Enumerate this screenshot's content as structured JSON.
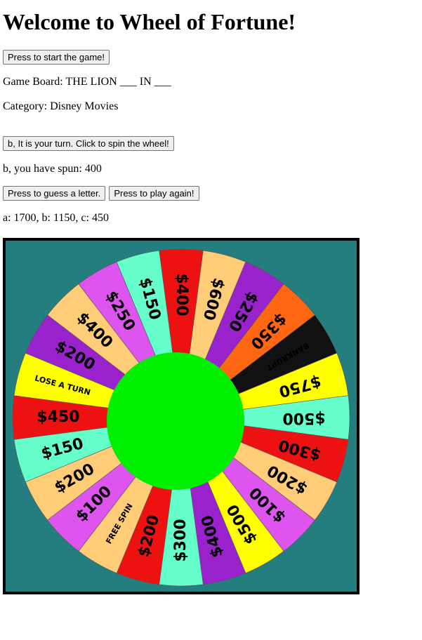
{
  "page": {
    "title": "Welcome to Wheel of Fortune!",
    "start_button": "Press to start the game!",
    "game_board": "Game Board: THE LION ___ IN ___",
    "category": "Category: Disney Movies",
    "spin_button": "b, It is your turn. Click to spin the wheel!",
    "spun_text": "b, you have spun: 400",
    "guess_button": "Press to guess a letter.",
    "play_again_button": "Press to play again!",
    "scores": "a: 1700, b: 1150, c: 450"
  },
  "wheel": {
    "background_color": "#247e80",
    "hub_color": "#00ee00",
    "segments": [
      {
        "label": "$400",
        "color": "#ee1111"
      },
      {
        "label": "$600",
        "color": "#ffcc77"
      },
      {
        "label": "$250",
        "color": "#9922cc"
      },
      {
        "label": "$350",
        "color": "#ff6611"
      },
      {
        "label": "BANKRUPT",
        "color": "#111111",
        "text_color": "#ffffff"
      },
      {
        "label": "$750",
        "color": "#ffff00"
      },
      {
        "label": "$500",
        "color": "#66ffcc"
      },
      {
        "label": "$300",
        "color": "#ee1111"
      },
      {
        "label": "$200",
        "color": "#ffcc77"
      },
      {
        "label": "$100",
        "color": "#dd55ee"
      },
      {
        "label": "$500",
        "color": "#ffff00"
      },
      {
        "label": "$400",
        "color": "#9922cc"
      },
      {
        "label": "$300",
        "color": "#66ffcc"
      },
      {
        "label": "$200",
        "color": "#ee1111"
      },
      {
        "label": "FREE SPIN",
        "color": "#ffcc77"
      },
      {
        "label": "$100",
        "color": "#dd55ee"
      },
      {
        "label": "$200",
        "color": "#ffcc77"
      },
      {
        "label": "$150",
        "color": "#66ffcc"
      },
      {
        "label": "$450",
        "color": "#ee1111"
      },
      {
        "label": "LOSE A TURN",
        "color": "#ffff00"
      },
      {
        "label": "$200",
        "color": "#9922cc"
      },
      {
        "label": "$400",
        "color": "#ffcc77"
      },
      {
        "label": "$250",
        "color": "#dd55ee"
      },
      {
        "label": "$150",
        "color": "#66ffcc"
      }
    ]
  }
}
